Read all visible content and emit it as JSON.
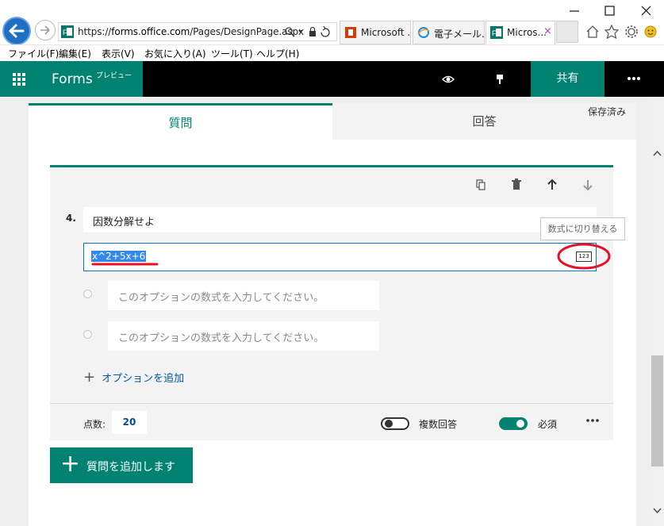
{
  "browser": {
    "url": "https://forms.office.com/Pages/DesignPage.aspx",
    "url_prefix": "https://",
    "url_host": "forms.office.com",
    "url_path": "/Pages/DesignPage.aspx",
    "tabs": [
      {
        "label": "Microsoft ...",
        "icon": "office-icon"
      },
      {
        "label": "電子メール...",
        "icon": "ie-icon"
      },
      {
        "label": "Micros...",
        "icon": "forms-icon",
        "active": true,
        "close": "×"
      }
    ],
    "menu": [
      "ファイル(F)",
      "編集(E)",
      "表示(V)",
      "お気に入り(A)",
      "ツール(T)",
      "ヘルプ(H)"
    ]
  },
  "app": {
    "name": "Forms",
    "badge": "プレビュー",
    "share_label": "共有",
    "saved_status": "保存済み",
    "tabs": [
      "質問",
      "回答"
    ]
  },
  "question": {
    "number": "4.",
    "title": "因数分解せよ",
    "formula": "x^2+5x+6",
    "math_toggle_label": "123",
    "tooltip": "数式に切り替える",
    "options": [
      {
        "placeholder": "このオプションの数式を入力してください。"
      },
      {
        "placeholder": "このオプションの数式を入力してください。"
      }
    ],
    "add_option_label": "オプションを追加",
    "points_label": "点数:",
    "points_value": "20",
    "multiple_answers_label": "複数回答",
    "multiple_answers": false,
    "required_label": "必須",
    "required": true
  },
  "add_question_label": "質問を追加します",
  "colors": {
    "accent": "#008272",
    "annotation": "#e81123",
    "selection": "#3388ee"
  }
}
